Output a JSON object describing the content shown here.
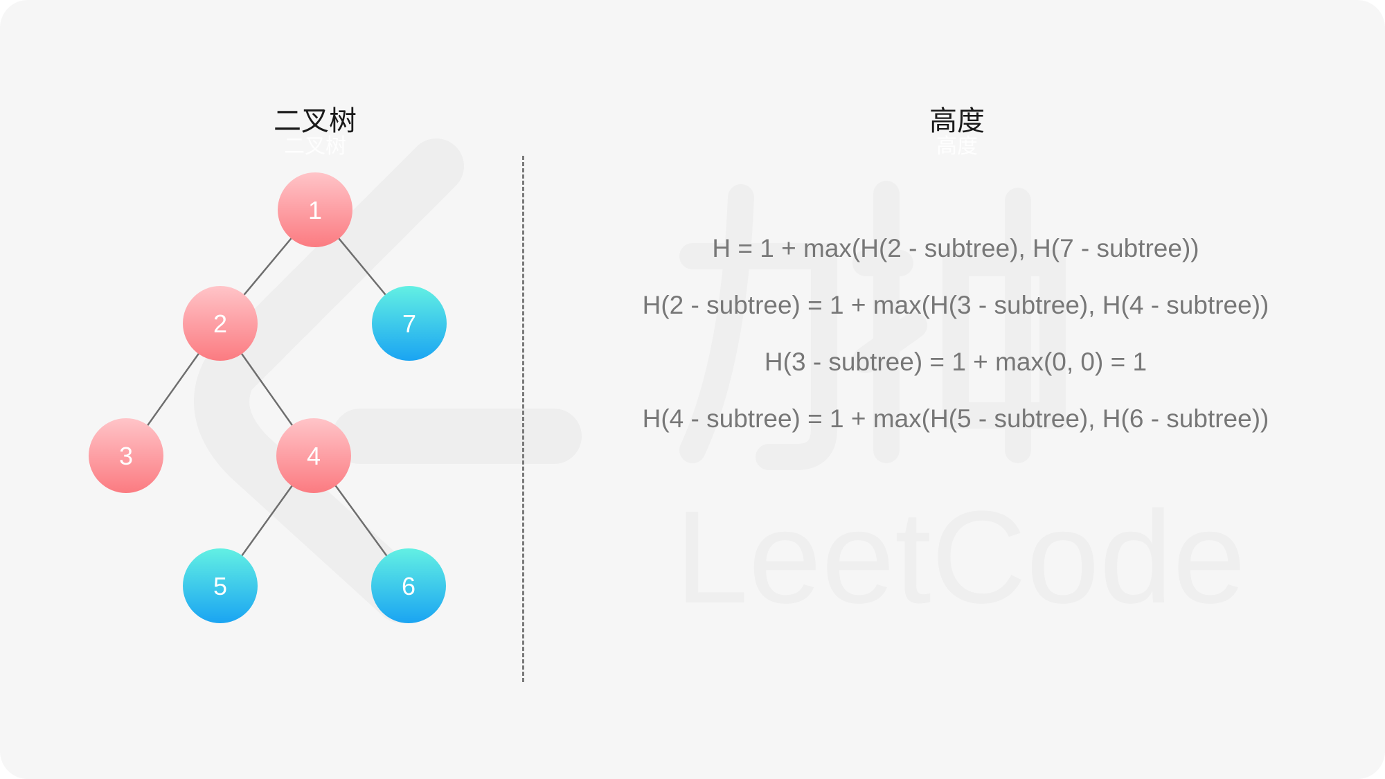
{
  "headings": {
    "tree": "二叉树",
    "height": "高度"
  },
  "formulas": [
    "H = 1 + max(H(2 - subtree), H(7 - subtree))",
    "H(2 - subtree) = 1 + max(H(3 - subtree), H(4 - subtree))",
    "H(3 - subtree) = 1 + max(0, 0) = 1",
    "H(4 - subtree) = 1 + max(H(5 - subtree), H(6 - subtree))"
  ],
  "tree": {
    "nodes": [
      {
        "id": "1",
        "label": "1",
        "color": "red"
      },
      {
        "id": "2",
        "label": "2",
        "color": "red"
      },
      {
        "id": "7",
        "label": "7",
        "color": "blue"
      },
      {
        "id": "3",
        "label": "3",
        "color": "red"
      },
      {
        "id": "4",
        "label": "4",
        "color": "red"
      },
      {
        "id": "5",
        "label": "5",
        "color": "blue"
      },
      {
        "id": "6",
        "label": "6",
        "color": "blue"
      }
    ],
    "edges": [
      [
        "1",
        "2"
      ],
      [
        "1",
        "7"
      ],
      [
        "2",
        "3"
      ],
      [
        "2",
        "4"
      ],
      [
        "4",
        "5"
      ],
      [
        "4",
        "6"
      ]
    ]
  },
  "watermark": {
    "text": "LeetCode",
    "cn_text": "力扣"
  },
  "colors": {
    "red_top": "#ffc4c8",
    "red_bottom": "#fb7b81",
    "blue_top": "#63f0e3",
    "blue_bottom": "#1aa4f2",
    "edge": "#6e6e6e",
    "background": "#f6f6f6"
  }
}
